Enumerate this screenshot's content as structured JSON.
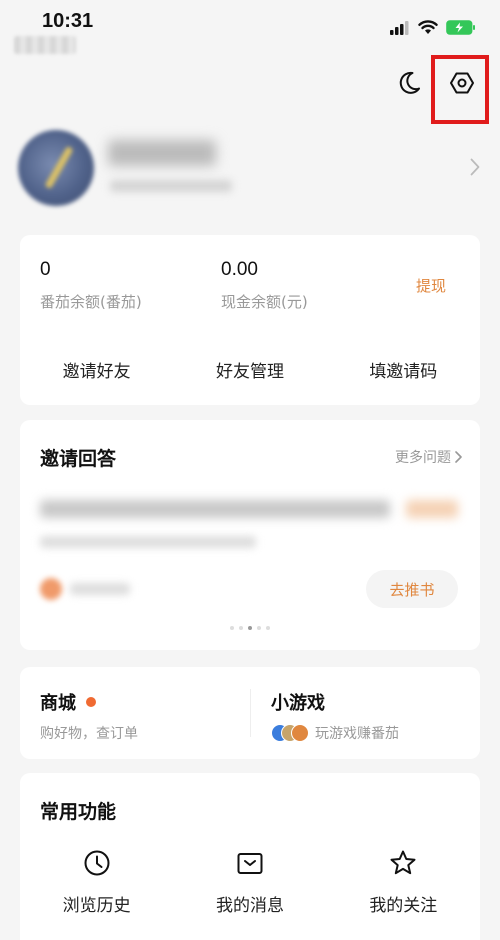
{
  "status_bar": {
    "time": "10:31"
  },
  "wallet": {
    "tomato_balance_value": "0",
    "tomato_balance_label": "番茄余额(番茄)",
    "cash_balance_value": "0.00",
    "cash_balance_label": "现金余额(元)",
    "withdraw_label": "提现",
    "actions": [
      "邀请好友",
      "好友管理",
      "填邀请码"
    ]
  },
  "qa": {
    "title": "邀请回答",
    "more_label": "更多问题",
    "recommend_label": "去推书"
  },
  "shop": {
    "mall_title": "商城",
    "mall_subtitle": "购好物，查订单",
    "games_title": "小游戏",
    "games_subtitle": "玩游戏赚番茄"
  },
  "features": {
    "title": "常用功能",
    "items": [
      {
        "label": "浏览历史",
        "icon": "clock-icon"
      },
      {
        "label": "我的消息",
        "icon": "message-box-icon"
      },
      {
        "label": "我的关注",
        "icon": "star-icon"
      }
    ]
  },
  "colors": {
    "accent": "#e0873f",
    "highlight": "#e01b1b",
    "battery": "#34c759"
  }
}
